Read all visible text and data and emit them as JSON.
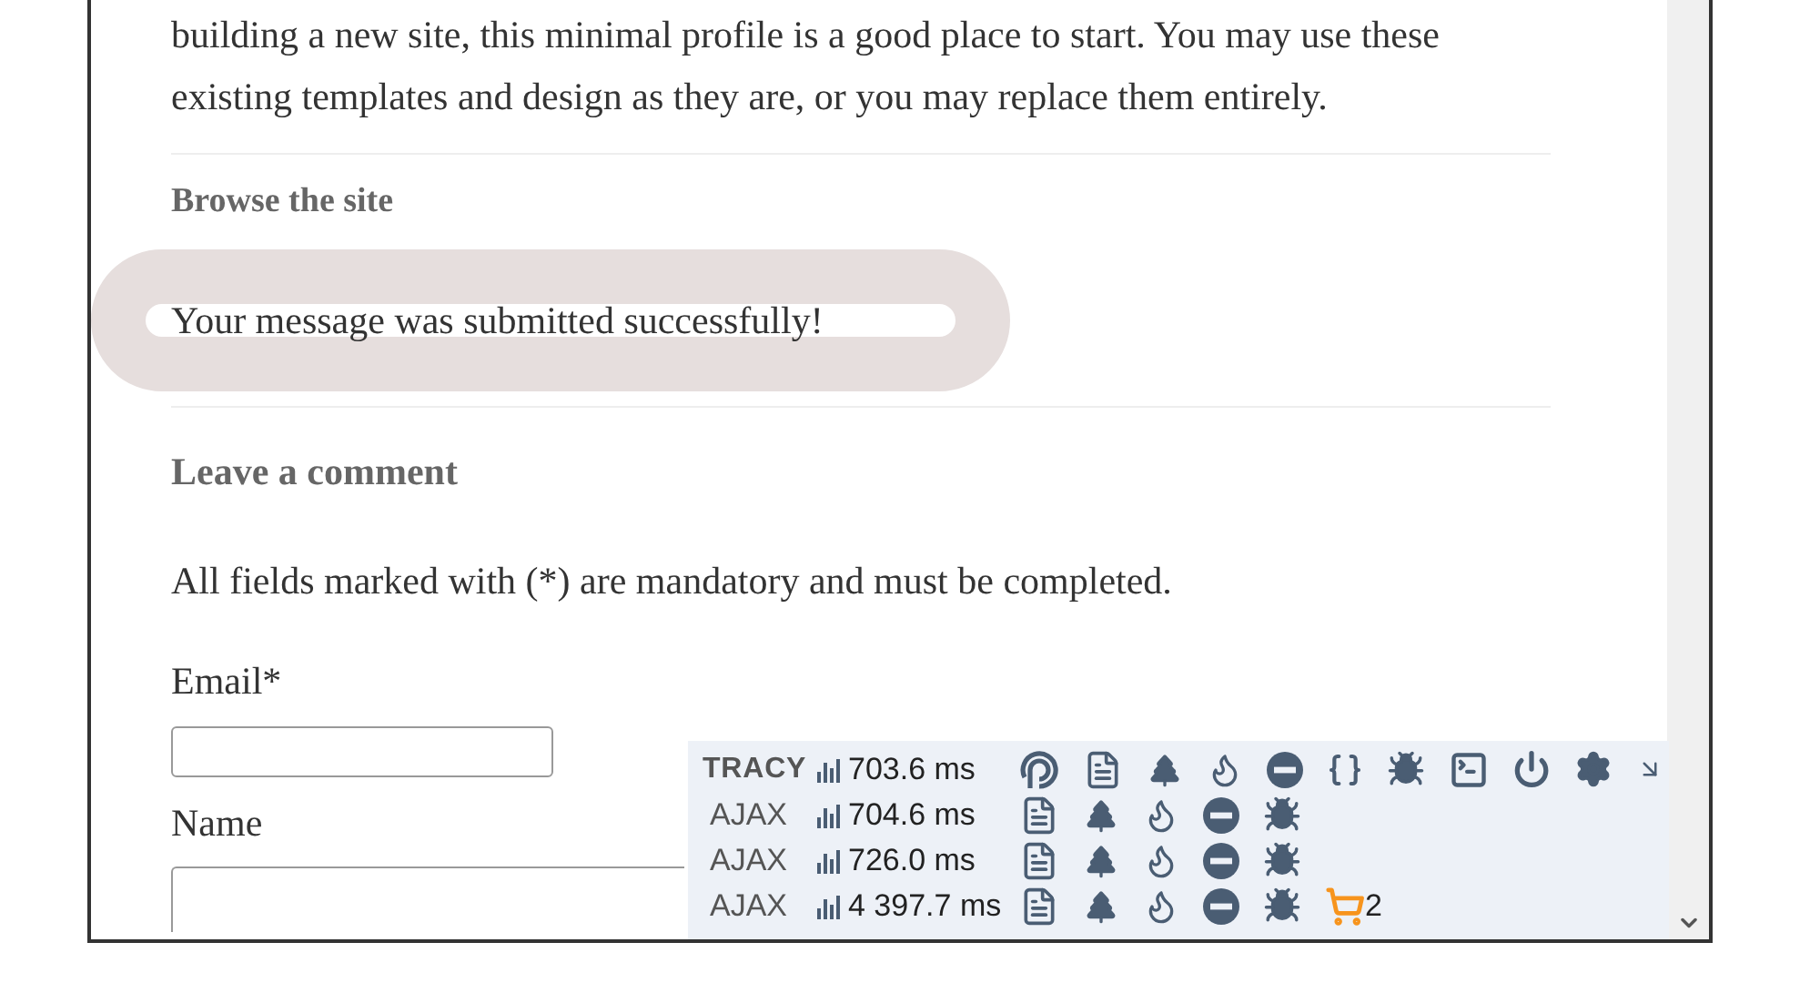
{
  "article": {
    "lines": [
      "building a new site, this minimal profile is a good place to start. You may use these",
      "existing templates and design as they are, or you may replace them entirely."
    ]
  },
  "browse_heading": "Browse the site",
  "status_message": "Your message was submitted successfully!",
  "comment_form": {
    "heading": "Leave a comment",
    "note": "All fields marked with (*) are mandatory and must be completed.",
    "fields": [
      {
        "label": "Email*",
        "kind": "input"
      },
      {
        "label": "Name",
        "kind": "input_wide"
      }
    ]
  },
  "debug_bar": {
    "rows": [
      {
        "kind": "main",
        "label": "TRACY",
        "time": "703.6 ms"
      },
      {
        "kind": "ajax",
        "label": "AJAX",
        "time": "704.6 ms"
      },
      {
        "kind": "ajax",
        "label": "AJAX",
        "time": "726.0 ms"
      },
      {
        "kind": "ajax",
        "label": "AJAX",
        "time": "4 397.7 ms",
        "cart_count": "2"
      }
    ]
  }
}
